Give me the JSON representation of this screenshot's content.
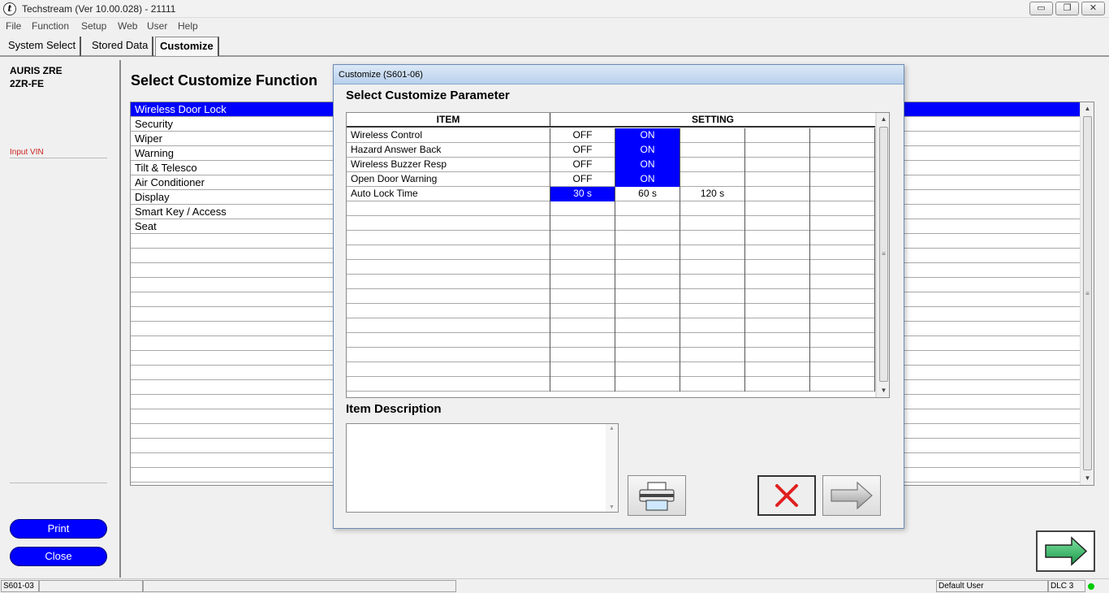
{
  "window": {
    "title": "Techstream (Ver 10.00.028) - 21111",
    "controls": {
      "minimize": "▭",
      "restore": "❐",
      "close": "✕"
    }
  },
  "menu": [
    "File",
    "Function",
    "Setup",
    "Web",
    "User",
    "Help"
  ],
  "tabs": [
    "System Select",
    "Stored Data",
    "Customize"
  ],
  "vehicle": {
    "model": "AURIS ZRE",
    "engine": "2ZR-FE",
    "input_vin": "Input VIN"
  },
  "left_buttons": {
    "print": "Print",
    "close": "Close"
  },
  "main": {
    "heading": "Select Customize Function",
    "functions": [
      "Wireless Door Lock",
      "Security",
      "Wiper",
      "Warning",
      "Tilt & Telesco",
      "Air Conditioner",
      "Display",
      "Smart Key / Access",
      "Seat"
    ],
    "selected_index": 0
  },
  "dialog": {
    "title": "Customize (S601-06)",
    "heading": "Select Customize Parameter",
    "columns": {
      "item": "ITEM",
      "setting": "SETTING"
    },
    "rows": [
      {
        "item": "Wireless Control",
        "options": [
          "OFF",
          "ON"
        ],
        "selected": 1
      },
      {
        "item": "Hazard Answer Back",
        "options": [
          "OFF",
          "ON"
        ],
        "selected": 1
      },
      {
        "item": "Wireless Buzzer Resp",
        "options": [
          "OFF",
          "ON"
        ],
        "selected": 1
      },
      {
        "item": "Open Door Warning",
        "options": [
          "OFF",
          "ON"
        ],
        "selected": 1
      },
      {
        "item": "Auto Lock Time",
        "options": [
          "30 s",
          "60 s",
          "120 s"
        ],
        "selected": 0
      }
    ],
    "description_label": "Item Description",
    "description_text": ""
  },
  "statusbar": {
    "screen_id": "S601-03",
    "user": "Default User",
    "connection": "DLC 3"
  },
  "colors": {
    "selection": "#0000ff",
    "pill": "#0000ff",
    "led": "#00cc00",
    "cancel_x": "#e02020",
    "next_arrow": "#22aa55"
  }
}
